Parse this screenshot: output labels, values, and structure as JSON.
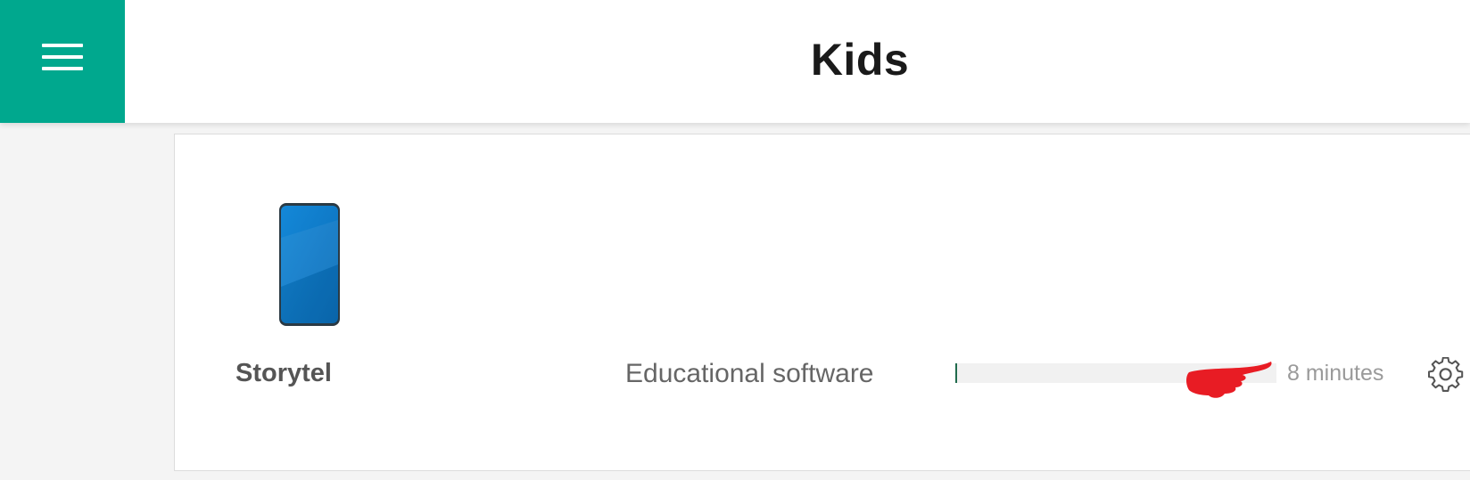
{
  "header": {
    "title": "Kids",
    "menu_icon": "hamburger-menu-icon",
    "accent_color": "#00a88e"
  },
  "apps": [
    {
      "name": "Storytel",
      "device_icon": "smartphone-icon",
      "category": "Educational software",
      "usage_label": "8 minutes",
      "usage_fraction": 0.006,
      "settings_icon": "gear-icon"
    }
  ],
  "colors": {
    "progress_fill": "#1f6b4c",
    "progress_track": "#f1f1f1",
    "annotation_arrow": "#e81c24",
    "device_screen": "#0a78c8"
  }
}
